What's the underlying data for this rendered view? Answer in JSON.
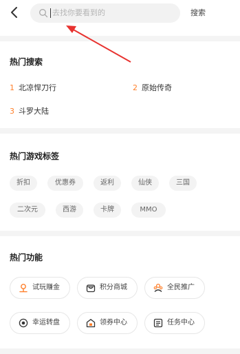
{
  "header": {
    "search_placeholder": "去找你要看到的",
    "search_button": "搜索"
  },
  "hot_search": {
    "title": "热门搜索",
    "items": [
      {
        "rank": "1",
        "label": "北凉悍刀行"
      },
      {
        "rank": "2",
        "label": "原始传奇"
      },
      {
        "rank": "3",
        "label": "斗罗大陆"
      }
    ]
  },
  "hot_tags": {
    "title": "热门游戏标签",
    "tags": [
      "折扣",
      "优惠券",
      "返利",
      "仙侠",
      "三国",
      "二次元",
      "西游",
      "卡牌",
      "MMO"
    ]
  },
  "hot_functions": {
    "title": "热门功能",
    "items": [
      {
        "label": "试玩赚金",
        "icon": "person-pin-icon"
      },
      {
        "label": "积分商城",
        "icon": "shop-icon"
      },
      {
        "label": "全民推广",
        "icon": "people-icon"
      },
      {
        "label": "幸运转盘",
        "icon": "wheel-icon"
      },
      {
        "label": "领券中心",
        "icon": "coupon-icon"
      },
      {
        "label": "任务中心",
        "icon": "task-list-icon"
      }
    ]
  },
  "colors": {
    "accent": "#ff7f2a",
    "annotation_arrow": "#e8322f"
  }
}
